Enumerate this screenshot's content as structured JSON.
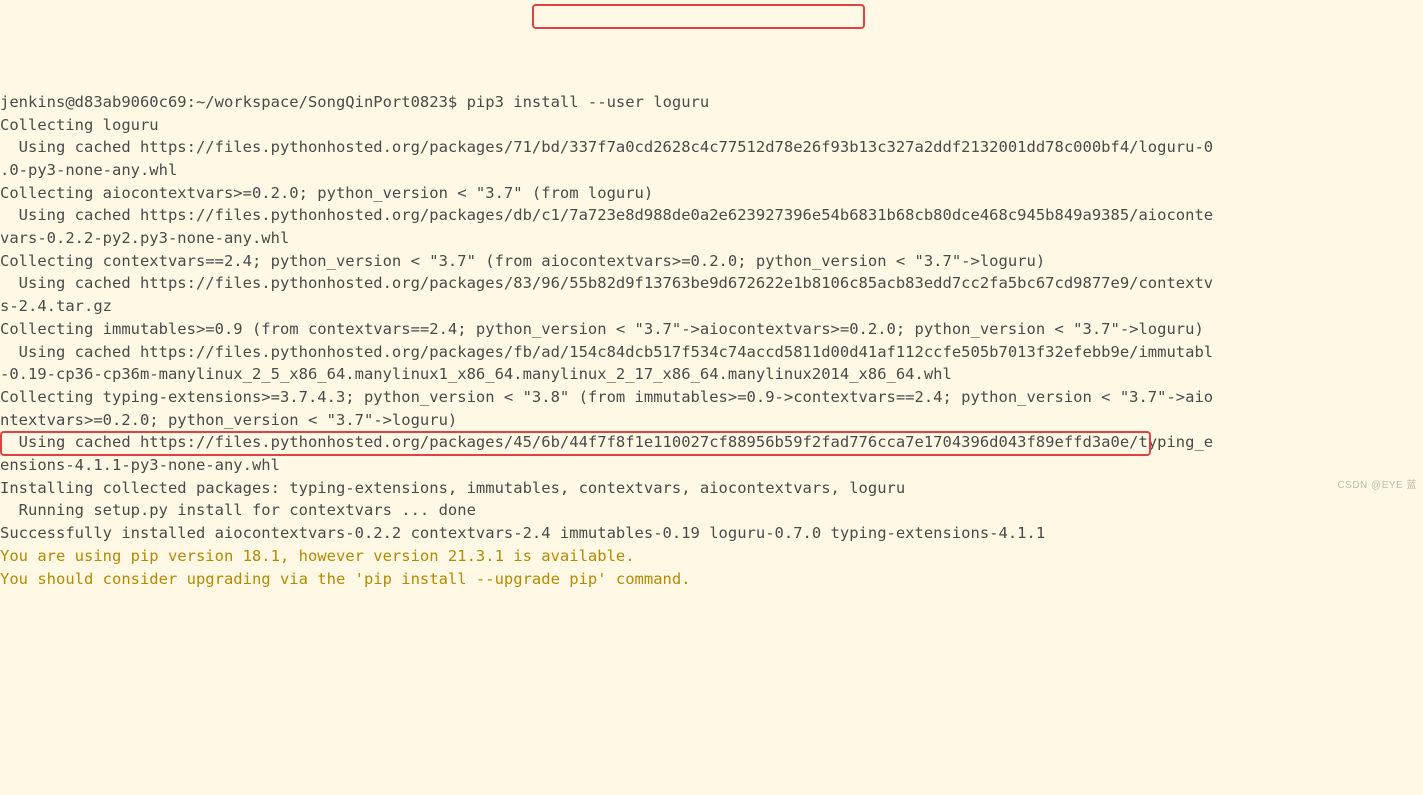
{
  "prompt": "jenkins@d83ab9060c69:~/workspace/SongQinPort0823$",
  "command": " pip3 install --user loguru",
  "lines": [
    "Collecting loguru",
    "  Using cached https://files.pythonhosted.org/packages/71/bd/337f7a0cd2628c4c77512d78e26f93b13c327a2ddf2132001dd78c000bf4/loguru-0",
    ".0-py3-none-any.whl",
    "Collecting aiocontextvars>=0.2.0; python_version < \"3.7\" (from loguru)",
    "  Using cached https://files.pythonhosted.org/packages/db/c1/7a723e8d988de0a2e623927396e54b6831b68cb80dce468c945b849a9385/aioconte",
    "vars-0.2.2-py2.py3-none-any.whl",
    "Collecting contextvars==2.4; python_version < \"3.7\" (from aiocontextvars>=0.2.0; python_version < \"3.7\"->loguru)",
    "  Using cached https://files.pythonhosted.org/packages/83/96/55b82d9f13763be9d672622e1b8106c85acb83edd7cc2fa5bc67cd9877e9/contextv",
    "s-2.4.tar.gz",
    "Collecting immutables>=0.9 (from contextvars==2.4; python_version < \"3.7\"->aiocontextvars>=0.2.0; python_version < \"3.7\"->loguru)",
    "  Using cached https://files.pythonhosted.org/packages/fb/ad/154c84dcb517f534c74accd5811d00d41af112ccfe505b7013f32efebb9e/immutabl",
    "-0.19-cp36-cp36m-manylinux_2_5_x86_64.manylinux1_x86_64.manylinux_2_17_x86_64.manylinux2014_x86_64.whl",
    "Collecting typing-extensions>=3.7.4.3; python_version < \"3.8\" (from immutables>=0.9->contextvars==2.4; python_version < \"3.7\"->aio",
    "ntextvars>=0.2.0; python_version < \"3.7\"->loguru)",
    "  Using cached https://files.pythonhosted.org/packages/45/6b/44f7f8f1e110027cf88956b59f2fad776cca7e1704396d043f89effd3a0e/typing_e",
    "ensions-4.1.1-py3-none-any.whl",
    "Installing collected packages: typing-extensions, immutables, contextvars, aiocontextvars, loguru",
    "  Running setup.py install for contextvars ... done",
    "Successfully installed aiocontextvars-0.2.2 contextvars-2.4 immutables-0.19 loguru-0.7.0 typing-extensions-4.1.1"
  ],
  "warn1": "You are using pip version 18.1, however version 21.3.1 is available.",
  "warn2": "You should consider upgrading via the 'pip install --upgrade pip' command.",
  "watermark": "CSDN @EYE 蓝"
}
